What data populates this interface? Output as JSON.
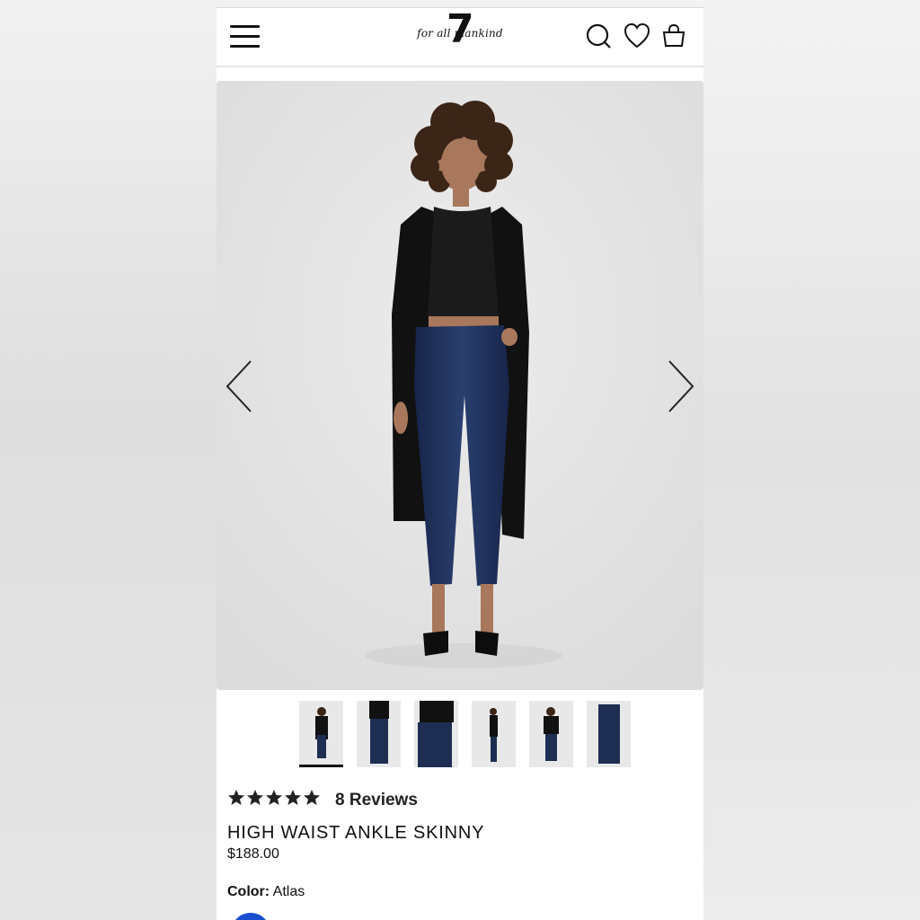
{
  "header": {
    "logo_text": "for all mankind",
    "logo_mark": "7",
    "icons": [
      "menu-icon",
      "search-icon",
      "heart-icon",
      "bag-icon"
    ]
  },
  "gallery": {
    "thumbnail_count": 6,
    "active_index": 0
  },
  "product": {
    "rating": 5,
    "reviews_label": "8 Reviews",
    "title": "HIGH WAIST ANKLE SKINNY",
    "price": "$188.00",
    "color_label": "Color:",
    "color_value": "Atlas"
  },
  "colors": {
    "swatch": "#1a4fd0",
    "denim": "#1d2e52",
    "text": "#111111"
  }
}
